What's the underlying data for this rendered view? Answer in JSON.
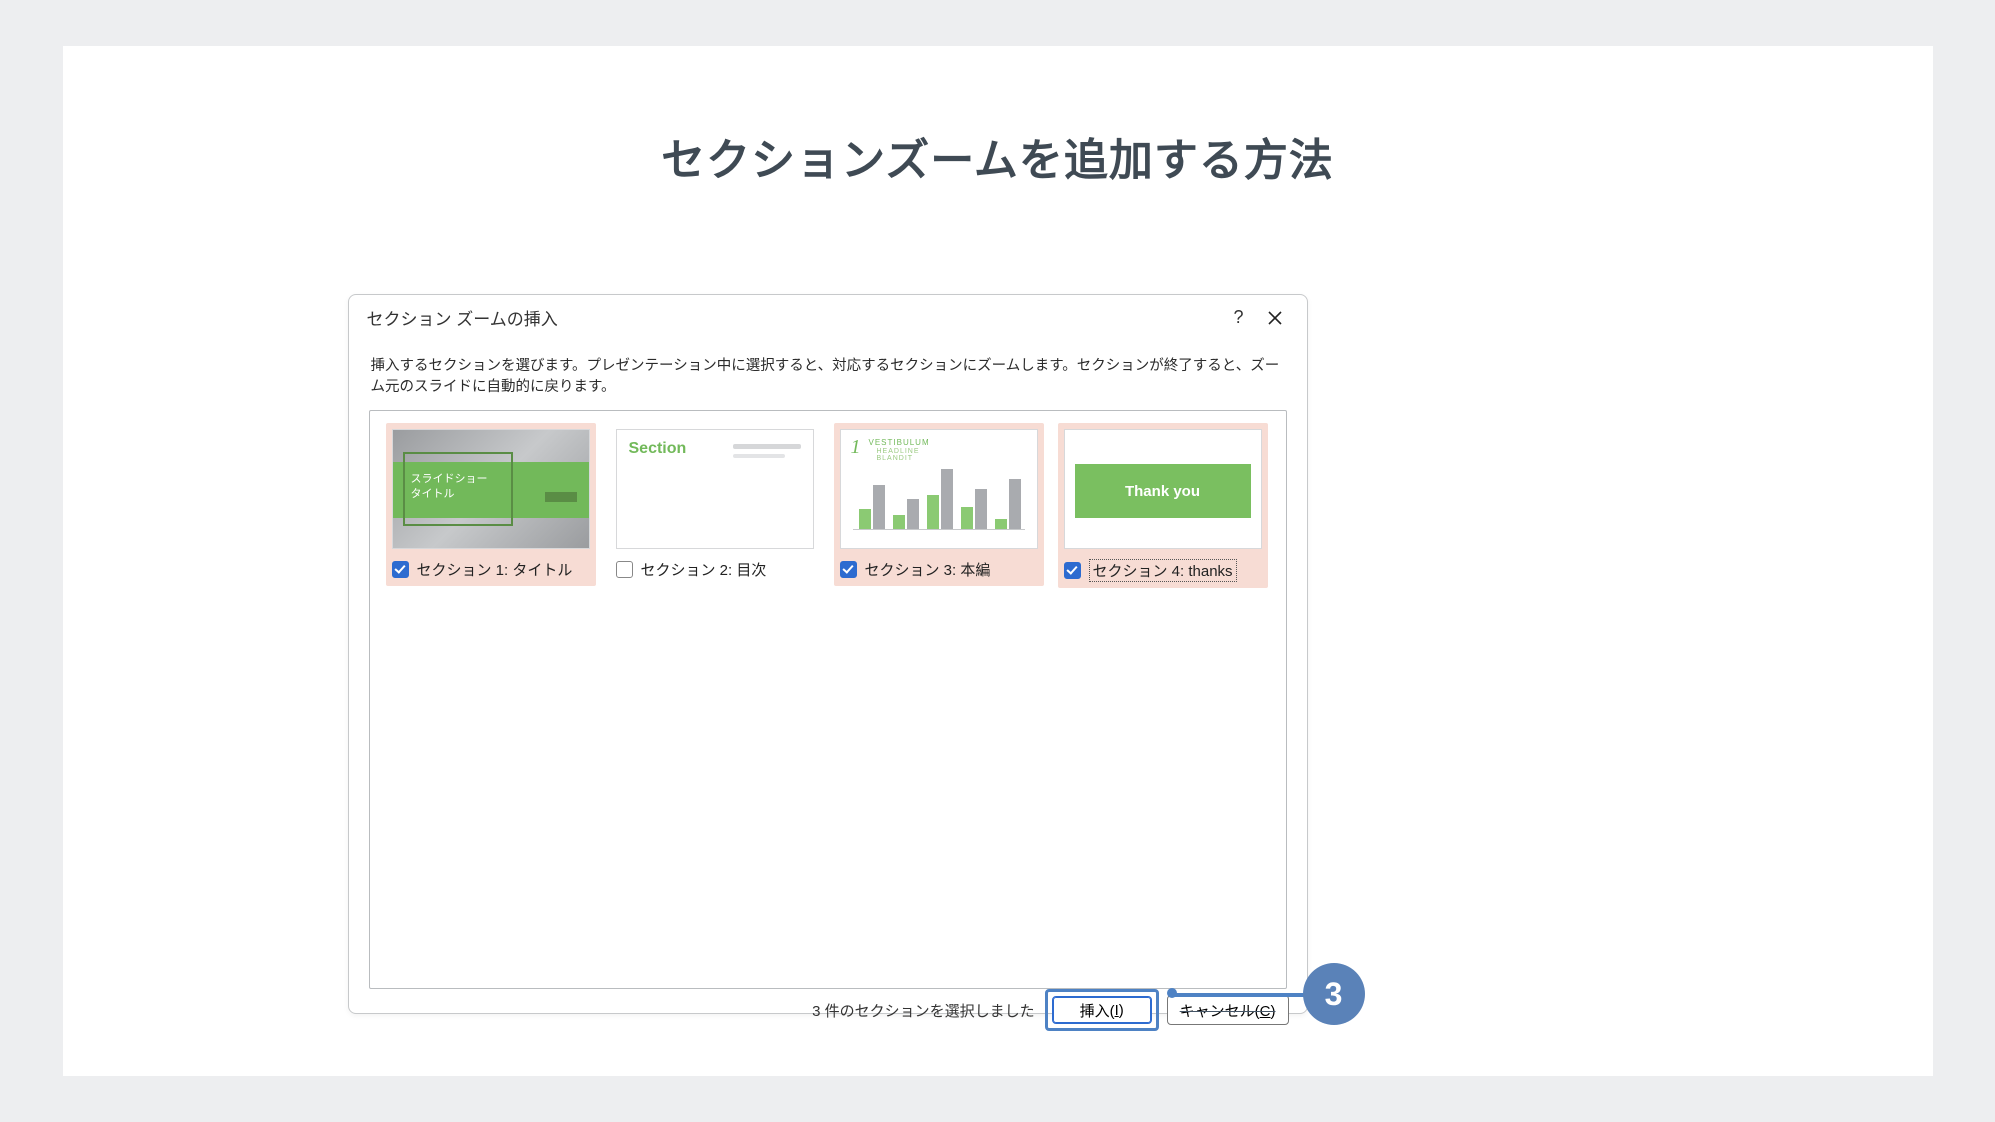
{
  "page": {
    "title": "セクションズームを追加する方法"
  },
  "dialog": {
    "title": "セクション ズームの挿入",
    "help_label": "?",
    "description": "挿入するセクションを選びます。プレゼンテーション中に選択すると、対応するセクションにズームします。セクションが終了すると、ズーム元のスライドに自動的に戻ります。",
    "sections": [
      {
        "label": "セクション 1: タイトル",
        "checked": true,
        "thumb_text_line1": "スライドショー",
        "thumb_text_line2": "タイトル"
      },
      {
        "label": "セクション 2: 目次",
        "checked": false,
        "thumb_heading": "Section"
      },
      {
        "label": "セクション 3: 本編",
        "checked": true,
        "thumb_num": "1",
        "thumb_head1": "VESTIBULUM",
        "thumb_head2": "HEADLINE",
        "thumb_head3": "BLANDIT"
      },
      {
        "label": "セクション 4: thanks",
        "checked": true,
        "thumb_banner": "Thank you",
        "focused": true
      }
    ],
    "footer": {
      "status": "3 件のセクションを選択しました",
      "insert_label": "挿入(",
      "insert_key": "I",
      "insert_close": ")",
      "cancel_label": "キャンセル(",
      "cancel_key": "C",
      "cancel_close": ")"
    }
  },
  "annotation": {
    "badge": "3"
  }
}
